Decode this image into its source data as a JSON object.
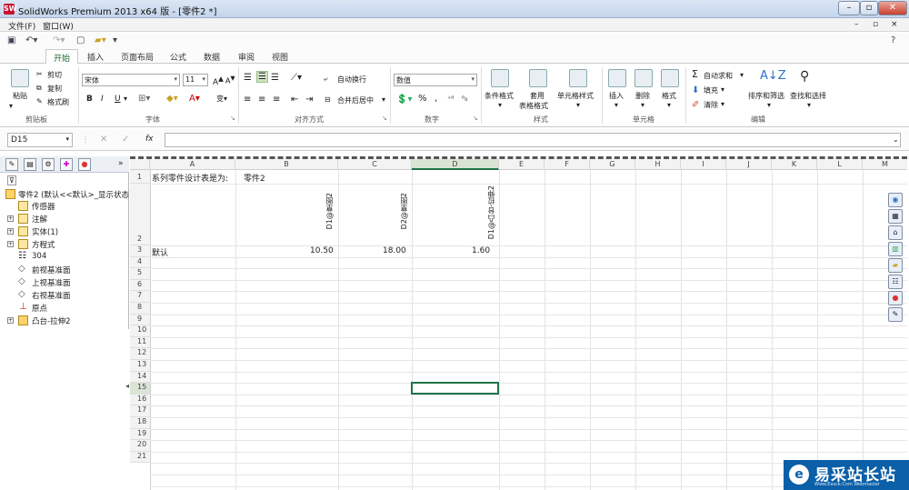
{
  "window": {
    "title": "SolidWorks Premium 2013 x64 版 - [零件2 *]",
    "logo": "SW"
  },
  "menubar": {
    "items": [
      "文件(F)",
      "窗口(W)"
    ],
    "help": "?"
  },
  "tabs": [
    "开始",
    "插入",
    "页面布局",
    "公式",
    "数据",
    "审阅",
    "视图"
  ],
  "ribbon": {
    "clipboard": {
      "paste": "粘贴",
      "cut": "剪切",
      "copy": "复制",
      "format_painter": "格式刷",
      "label": "剪贴板"
    },
    "font": {
      "name": "宋体",
      "size": "11",
      "bold": "B",
      "italic": "I",
      "underline": "U",
      "label": "字体"
    },
    "alignment": {
      "wrap": "自动换行",
      "merge": "合并后居中",
      "label": "对齐方式"
    },
    "number": {
      "format": "数值",
      "percent": "%",
      "comma": ",",
      "label": "数字"
    },
    "styles": {
      "conditional": "条件格式",
      "table_line1": "套用",
      "table_line2": "表格格式",
      "cell_styles": "单元格样式",
      "label": "样式"
    },
    "cells": {
      "insert": "插入",
      "delete": "删除",
      "format": "格式",
      "label": "单元格"
    },
    "editing": {
      "autosum": "自动求和",
      "fill": "填充",
      "clear": "清除",
      "sort": "排序和筛选",
      "find": "查找和选择",
      "label": "编辑"
    }
  },
  "formula_bar": {
    "name_box": "D15",
    "fx": "fx",
    "value": ""
  },
  "tree": {
    "root": "零件2  (默认<<默认>_显示状态",
    "items": [
      "传感器",
      "注解",
      "实体(1)",
      "方程式",
      "304",
      "前视基准面",
      "上视基准面",
      "右视基准面",
      "原点",
      "凸台-拉伸2"
    ]
  },
  "sheet": {
    "columns": [
      "A",
      "B",
      "C",
      "D",
      "E",
      "F",
      "G",
      "H",
      "I",
      "J",
      "K",
      "L",
      "M"
    ],
    "rows": [
      "1",
      "2",
      "3",
      "4",
      "5",
      "6",
      "7",
      "8",
      "9",
      "10",
      "11",
      "12",
      "13",
      "14",
      "15",
      "16",
      "17",
      "18",
      "19",
      "20",
      "21"
    ],
    "a1": "系列零件设计表是为:",
    "b1": "零件2",
    "headers": [
      "D1@草图2",
      "D2@草图2",
      "D1@凸台-拉伸2"
    ],
    "a3": "默认",
    "values": [
      "10.50",
      "18.00",
      "1.60"
    ],
    "selected_cell": "D15"
  },
  "watermark": {
    "text": "易采站长站",
    "sub": "Www.Easck.Com  Webmaster"
  }
}
